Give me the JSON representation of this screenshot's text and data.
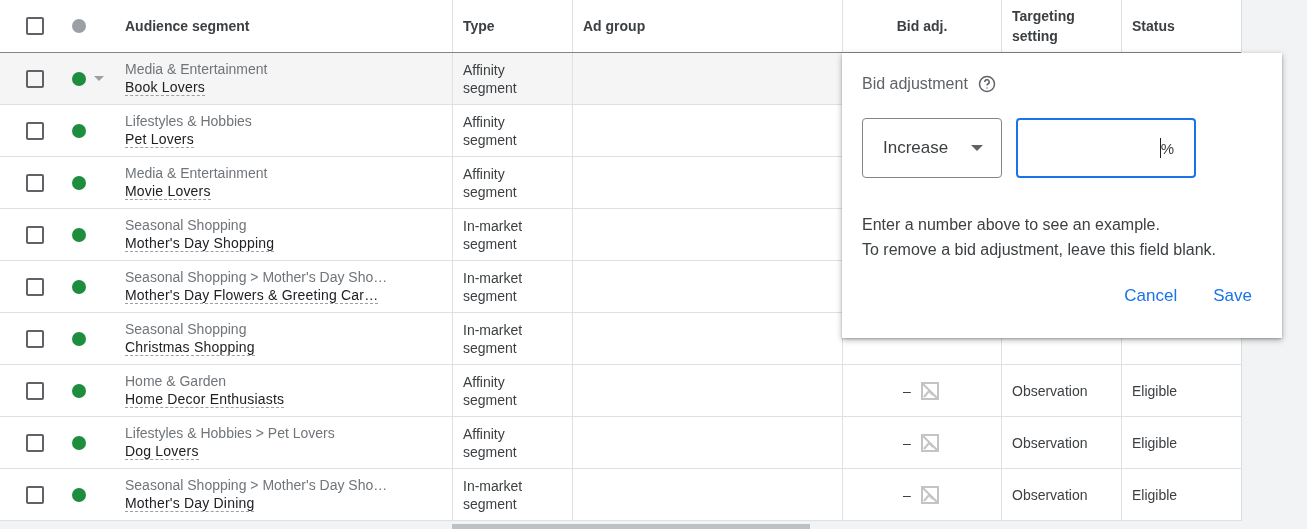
{
  "table": {
    "all_selected": false,
    "columns": [
      "Audience segment",
      "Type",
      "Ad group",
      "Bid adj.",
      "Targeting setting",
      "Status"
    ],
    "rows": [
      {
        "selected": false,
        "hovered": true,
        "enabled": true,
        "category": "Media & Entertainment",
        "name": "Book Lovers",
        "type": "Affinity segment"
      },
      {
        "selected": false,
        "hovered": false,
        "enabled": true,
        "category": "Lifestyles & Hobbies",
        "name": "Pet Lovers",
        "type": "Affinity segment"
      },
      {
        "selected": false,
        "hovered": false,
        "enabled": true,
        "category": "Media & Entertainment",
        "name": "Movie Lovers",
        "type": "Affinity segment"
      },
      {
        "selected": false,
        "hovered": false,
        "enabled": true,
        "category": "Seasonal Shopping",
        "name": "Mother's Day Shopping",
        "type": "In-market segment"
      },
      {
        "selected": false,
        "hovered": false,
        "enabled": true,
        "category": "Seasonal Shopping > Mother's Day Sho…",
        "name": "Mother's Day Flowers & Greeting Car…",
        "type": "In-market segment"
      },
      {
        "selected": false,
        "hovered": false,
        "enabled": true,
        "category": "Seasonal Shopping",
        "name": "Christmas Shopping",
        "type": "In-market segment"
      },
      {
        "selected": false,
        "hovered": false,
        "enabled": true,
        "category": "Home & Garden",
        "name": "Home Decor Enthusiasts",
        "type": "Affinity segment",
        "bid_adj": "–",
        "targeting": "Observation",
        "status": "Eligible"
      },
      {
        "selected": false,
        "hovered": false,
        "enabled": true,
        "category": "Lifestyles & Hobbies > Pet Lovers",
        "name": "Dog Lovers",
        "type": "Affinity segment",
        "bid_adj": "–",
        "targeting": "Observation",
        "status": "Eligible"
      },
      {
        "selected": false,
        "hovered": false,
        "enabled": true,
        "category": "Seasonal Shopping > Mother's Day Sho…",
        "name": "Mother's Day Dining",
        "type": "In-market segment",
        "bid_adj": "–",
        "targeting": "Observation",
        "status": "Eligible"
      }
    ]
  },
  "popup": {
    "title": "Bid adjustment",
    "direction": "Increase",
    "value_suffix": "%",
    "help": [
      "Enter a number above to see an example.",
      "To remove a bid adjustment, leave this field blank."
    ],
    "buttons": [
      "Cancel",
      "Save"
    ]
  }
}
